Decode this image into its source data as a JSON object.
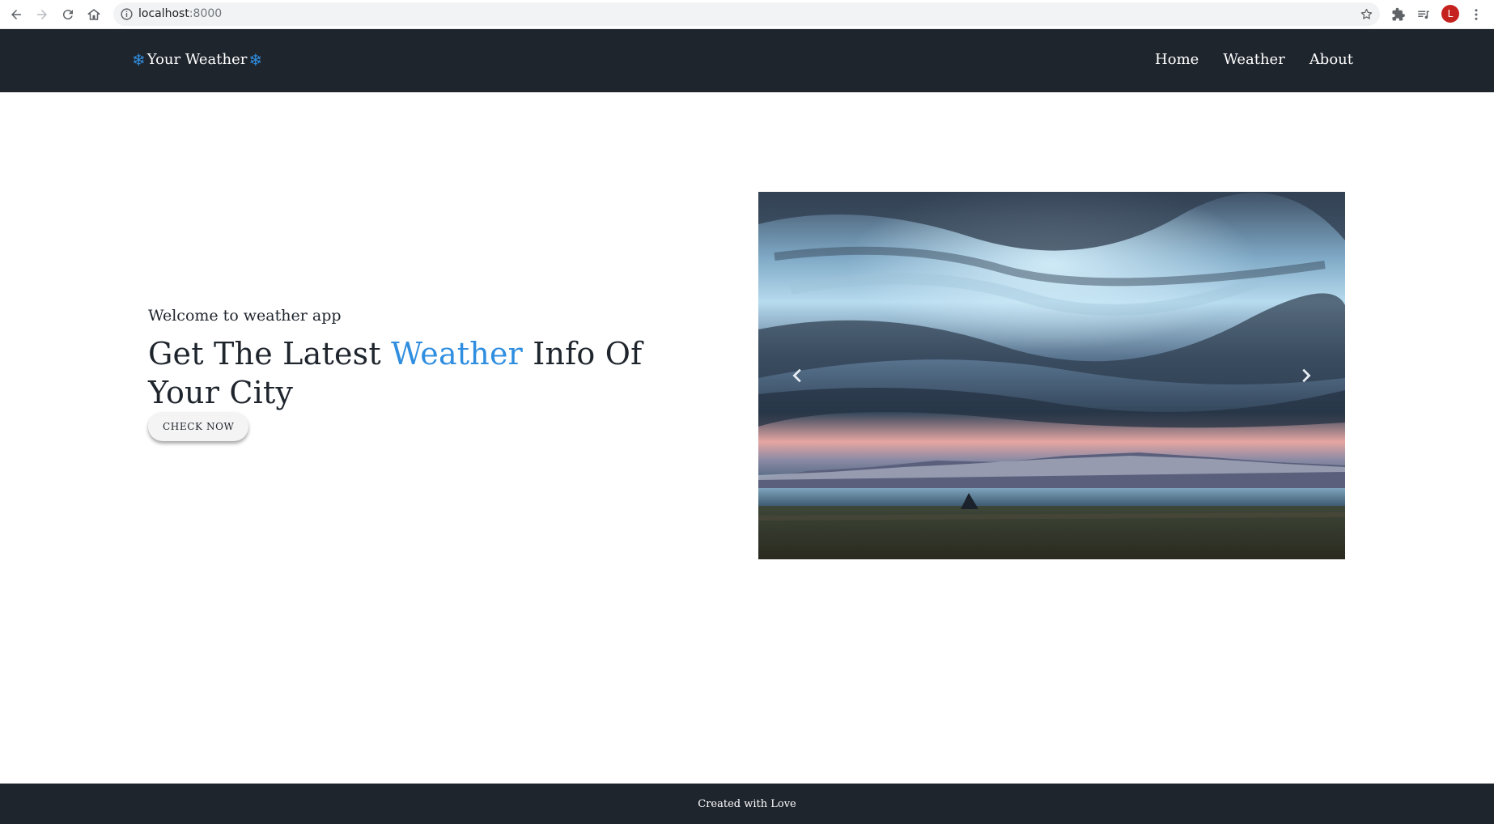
{
  "browser": {
    "url_host": "localhost",
    "url_port": ":8000",
    "profile_initial": "L",
    "icons": [
      "back-icon",
      "forward-icon",
      "reload-icon",
      "home-icon",
      "info-icon",
      "star-icon",
      "extensions-icon",
      "media-icon",
      "profile-avatar",
      "menu-icon"
    ]
  },
  "navbar": {
    "brand": "Your Weather",
    "brand_icon": "❄",
    "links": [
      "Home",
      "Weather",
      "About"
    ]
  },
  "hero": {
    "welcome": "Welcome to weather app",
    "headline_before": "Get The Latest ",
    "headline_accent": "Weather",
    "headline_after": " Info Of Your City",
    "button": "CHECK NOW"
  },
  "carousel": {
    "image": "stormy-sky-over-lake-landscape",
    "controls": [
      "previous-icon",
      "next-icon"
    ]
  },
  "footer": {
    "text": "Created with Love"
  },
  "colors": {
    "navbar_bg": "#1f252d",
    "accent": "#2f8ee0",
    "footer_bg": "#1f252d"
  }
}
